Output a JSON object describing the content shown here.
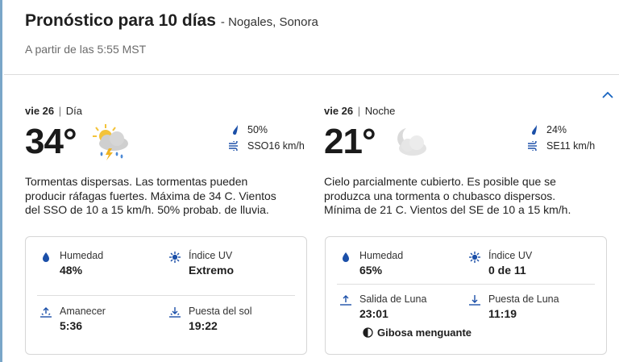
{
  "header": {
    "title": "Pronóstico para 10 días",
    "location": "- Nogales, Sonora",
    "as_of": "A partir de las 5:55 MST"
  },
  "colors": {
    "accent": "#1764c0",
    "icon_blue": "#1b4fa8",
    "cloud_gray": "#c9c9c9",
    "sun_yellow": "#f3c33a"
  },
  "day": {
    "day": "vie 26",
    "sep": "|",
    "part": "Día",
    "temp": "34°",
    "icon": "thunderstorm-sun-icon",
    "precip": "50%",
    "wind": "SSO16 km/h",
    "narrative": "Tormentas dispersas. Las tormentas pueden producir ráfagas fuertes. Máxima de 34 C. Vientos del SSO de 10 a 15 km/h. 50% probab. de lluvia.",
    "details": {
      "humidity_label": "Humedad",
      "humidity": "48%",
      "uv_label": "Índice UV",
      "uv": "Extremo",
      "sunrise_label": "Amanecer",
      "sunrise": "5:36",
      "sunset_label": "Puesta del sol",
      "sunset": "19:22"
    }
  },
  "night": {
    "day": "vie 26",
    "sep": "|",
    "part": "Noche",
    "temp": "21°",
    "icon": "partly-cloudy-moon-icon",
    "precip": "24%",
    "wind": "SE11 km/h",
    "narrative": "Cielo parcialmente cubierto. Es posible que se produzca una tormenta o chubasco dispersos. Mínima de 21 C. Vientos del SE de 10 a 15 km/h.",
    "details": {
      "humidity_label": "Humedad",
      "humidity": "65%",
      "uv_label": "Índice UV",
      "uv": "0 de 11",
      "moonrise_label": "Salida de Luna",
      "moonrise": "23:01",
      "moonset_label": "Puesta de Luna",
      "moonset": "11:19",
      "moon_phase": "Gibosa menguante"
    }
  }
}
